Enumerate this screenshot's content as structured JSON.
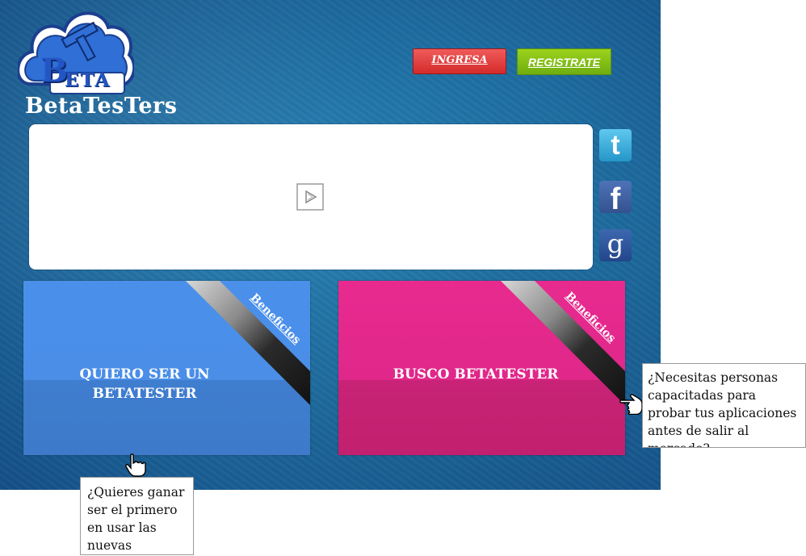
{
  "header": {
    "logo_text": "BETA",
    "logo_symbol": "T",
    "brand": "BetaTesTers",
    "login_label": "INGRESA",
    "register_label": "REGISTRATE"
  },
  "video": {
    "icon": "play-icon"
  },
  "social": [
    {
      "name": "twitter",
      "icon": "twitter-icon",
      "glyph": "t"
    },
    {
      "name": "facebook",
      "icon": "facebook-icon",
      "glyph": "f"
    },
    {
      "name": "google",
      "icon": "google-icon",
      "glyph": "g"
    }
  ],
  "cards": {
    "tester": {
      "label_line1": "QUIERO SER UN",
      "label_line2": "BETATESTER",
      "ribbon": "Beneficios",
      "color": "#4a8ee8"
    },
    "seeker": {
      "label": "BUSCO BETATESTER",
      "ribbon": "Beneficios",
      "color": "#e0278a"
    }
  },
  "tooltips": {
    "tester": [
      "¿Quieres ganar",
      "ser el primero",
      "en usar las",
      "nuevas"
    ],
    "seeker": [
      "¿Necesitas personas",
      "capacitadas para",
      "probar tus aplicaciones",
      "antes de salir al",
      "mercado?"
    ]
  },
  "colors": {
    "background": "#1f6fa3",
    "login": "#d42b2b",
    "register": "#7cbf12"
  }
}
